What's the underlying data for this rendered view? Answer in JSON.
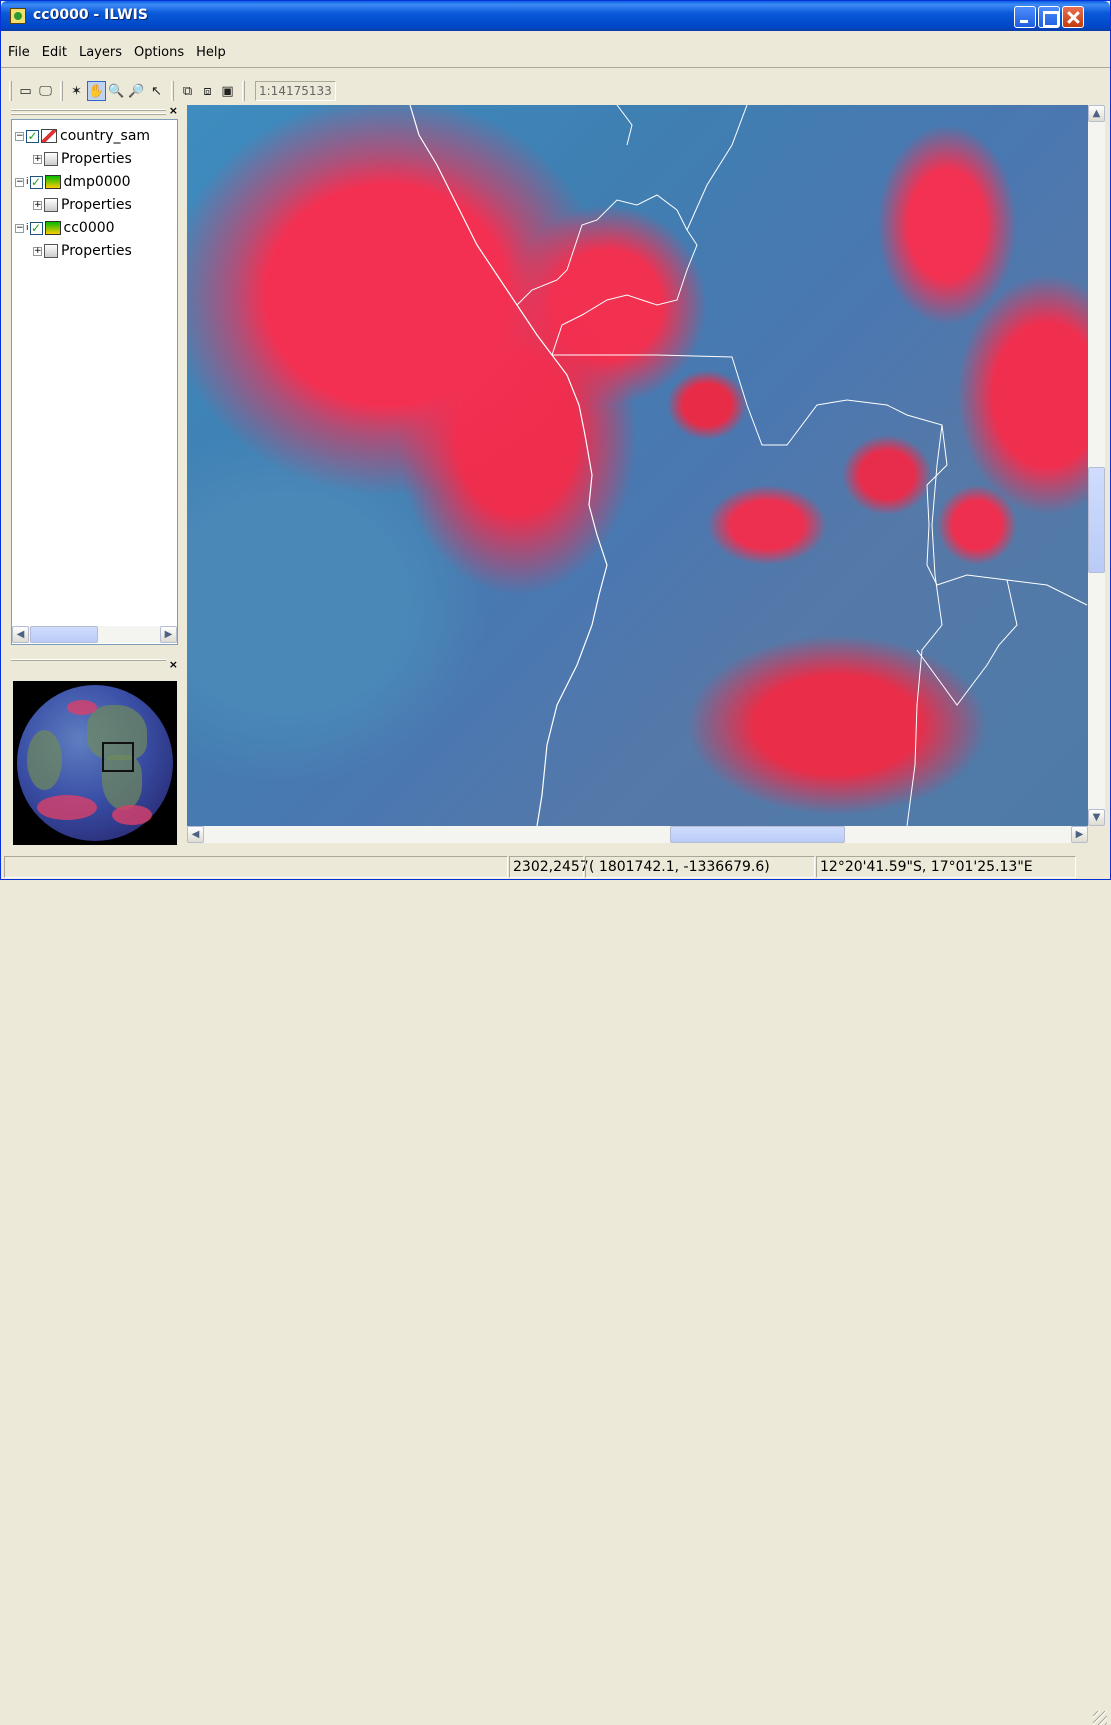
{
  "window": {
    "title": "cc0000 - ILWIS"
  },
  "menu": [
    "File",
    "Edit",
    "Layers",
    "Options",
    "Help"
  ],
  "toolbar": {
    "buttons": [
      {
        "name": "entire-map-icon",
        "glyph": "▭"
      },
      {
        "name": "normal-icon",
        "glyph": "🖵"
      },
      {
        "name": "measure-icon",
        "glyph": "✶"
      },
      {
        "name": "pan-icon",
        "glyph": "✋"
      },
      {
        "name": "zoom-in-icon",
        "glyph": "🔍"
      },
      {
        "name": "zoom-out-icon",
        "glyph": "🔎"
      },
      {
        "name": "select-icon",
        "glyph": "↖"
      },
      {
        "name": "add-layer-icon",
        "glyph": "⧉"
      },
      {
        "name": "remove-layer-icon",
        "glyph": "⧈"
      },
      {
        "name": "save-icon",
        "glyph": "▣"
      }
    ],
    "scale": "1:14175133"
  },
  "layers": [
    {
      "name": "country_sam",
      "checked": true,
      "properties_label": "Properties"
    },
    {
      "name": "dmp0000",
      "checked": true,
      "properties_label": "Properties"
    },
    {
      "name": "cc0000",
      "checked": true,
      "properties_label": "Properties"
    }
  ],
  "status": {
    "rowcol": "2302,2457",
    "xy": "( 1801742.1, -1336679.6)",
    "latlon": "12°20'41.59\"S, 17°01'25.13\"E"
  },
  "colors": {
    "title_bar": "#0a5ad9",
    "cloud_red": "#f43052",
    "ocean_blue": "#3e8cc0",
    "boundary": "#ffffff"
  }
}
